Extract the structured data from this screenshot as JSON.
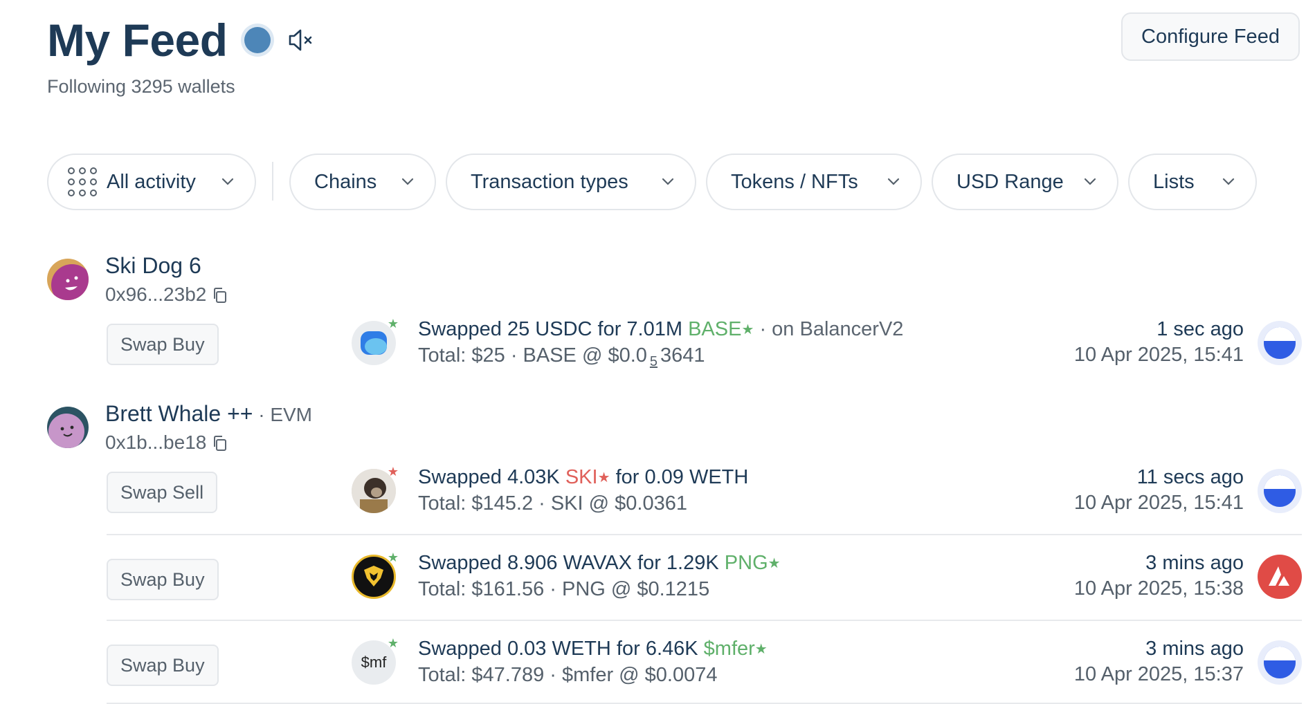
{
  "header": {
    "title": "My Feed",
    "subtitle": "Following 3295 wallets",
    "configure_label": "Configure Feed",
    "live_dot_color": "#4d86b8",
    "mute_icon": "speaker-muted-icon"
  },
  "filters": [
    {
      "label": "All activity",
      "icon": "grid-icon"
    },
    {
      "label": "Chains"
    },
    {
      "label": "Transaction types"
    },
    {
      "label": "Tokens / NFTs"
    },
    {
      "label": "USD Range"
    },
    {
      "label": "Lists"
    }
  ],
  "wallets": [
    {
      "name": "Ski Dog 6",
      "tag": "",
      "address": "0x96...23b2",
      "activities": [
        {
          "type_label": "Swap Buy",
          "desc_prefix": "Swapped 25 USDC for 7.01M ",
          "token": "BASE",
          "desc_suffix": " · on BalancerV2",
          "total_prefix": "Total: $25 · BASE @ $0.0",
          "total_sub": "5",
          "total_suffix": "3641",
          "ago": "1 sec ago",
          "date": "10 Apr 2025, 15:41",
          "chain": "base-chain-icon"
        }
      ]
    },
    {
      "name": "Brett Whale ++",
      "tag": " · EVM",
      "address": "0x1b...be18",
      "activities": [
        {
          "type_label": "Swap Sell",
          "desc_prefix": "Swapped 4.03K ",
          "token": "SKI",
          "desc_suffix": " for 0.09 WETH",
          "total": "Total: $145.2 · SKI @ $0.0361",
          "ago": "11 secs ago",
          "date": "10 Apr 2025, 15:41",
          "chain": "base-chain-icon"
        },
        {
          "type_label": "Swap Buy",
          "desc_prefix": "Swapped 8.906 WAVAX for 1.29K ",
          "token": "PNG",
          "total": "Total: $161.56 · PNG @ $0.1215",
          "ago": "3 mins ago",
          "date": "10 Apr 2025, 15:38",
          "chain": "avalanche-chain-icon"
        },
        {
          "type_label": "Swap Buy",
          "desc_prefix": "Swapped 0.03 WETH for 6.46K ",
          "token": "$mfer",
          "token_icon_text": "$mf",
          "total": "Total: $47.789 · $mfer @ $0.0074",
          "ago": "3 mins ago",
          "date": "10 Apr 2025, 15:37",
          "chain": "base-chain-icon"
        }
      ]
    }
  ],
  "colors": {
    "text": "#1e3a56",
    "muted": "#5b6570",
    "green": "#5fb06a",
    "red": "#e0605a",
    "base_blue": "#2f5ce4",
    "avax_red": "#e04b46"
  }
}
